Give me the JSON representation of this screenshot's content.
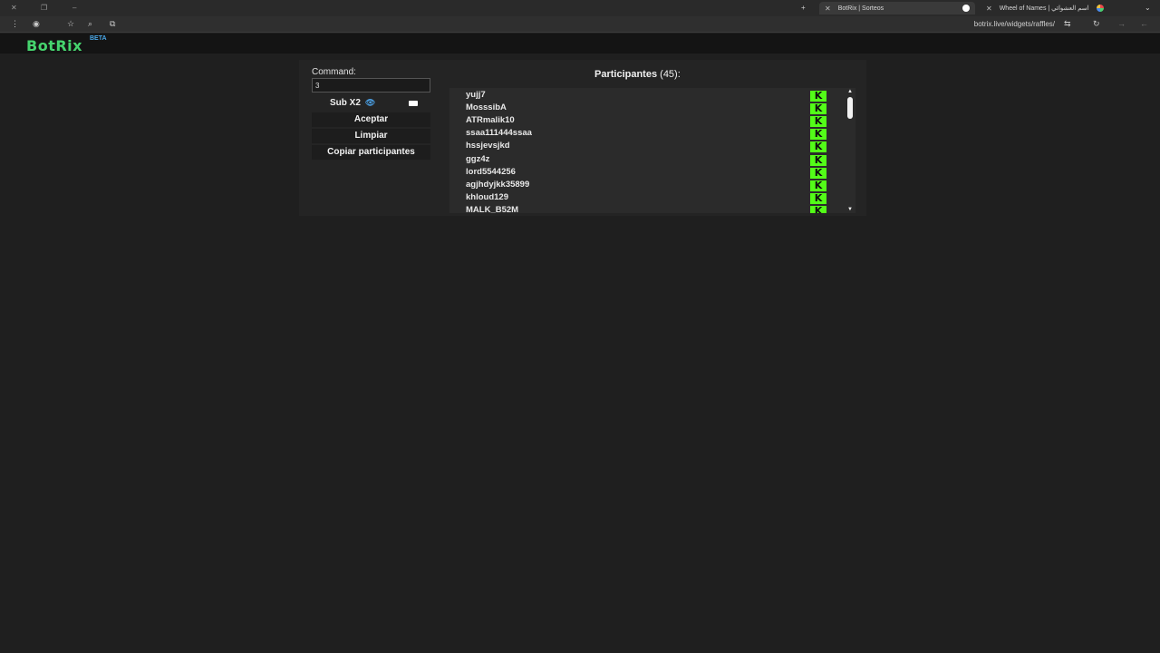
{
  "browser": {
    "tabs": [
      {
        "label": "BotRix | Sorteos",
        "active": true
      },
      {
        "label": "Wheel of Names | اسم العشوائي"
      }
    ],
    "url": "botrix.live/widgets/raffles/"
  },
  "site": {
    "logo": "BotRix",
    "badge": "BETA"
  },
  "widget": {
    "command_label": "Command:",
    "command_value": "3",
    "sub_label": "Sub X2",
    "accept_label": "Aceptar",
    "clear_label": "Limpiar",
    "copy_label": "Copiar participantes",
    "participants_title": "Participantes",
    "participants_count": "(45):",
    "participants": [
      "yujj7",
      "MosssibA",
      "ATRmalik10",
      "ssaa111444ssaa",
      "hssjevsjkd",
      "ggz4z",
      "lord5544256",
      "agjhdyjkk35899",
      "khloud129",
      "MALK_B52M"
    ],
    "platform_icon": "K"
  },
  "colors": {
    "brand": "#46d46e",
    "kick": "#53fc18",
    "beta": "#4aa8e8"
  }
}
